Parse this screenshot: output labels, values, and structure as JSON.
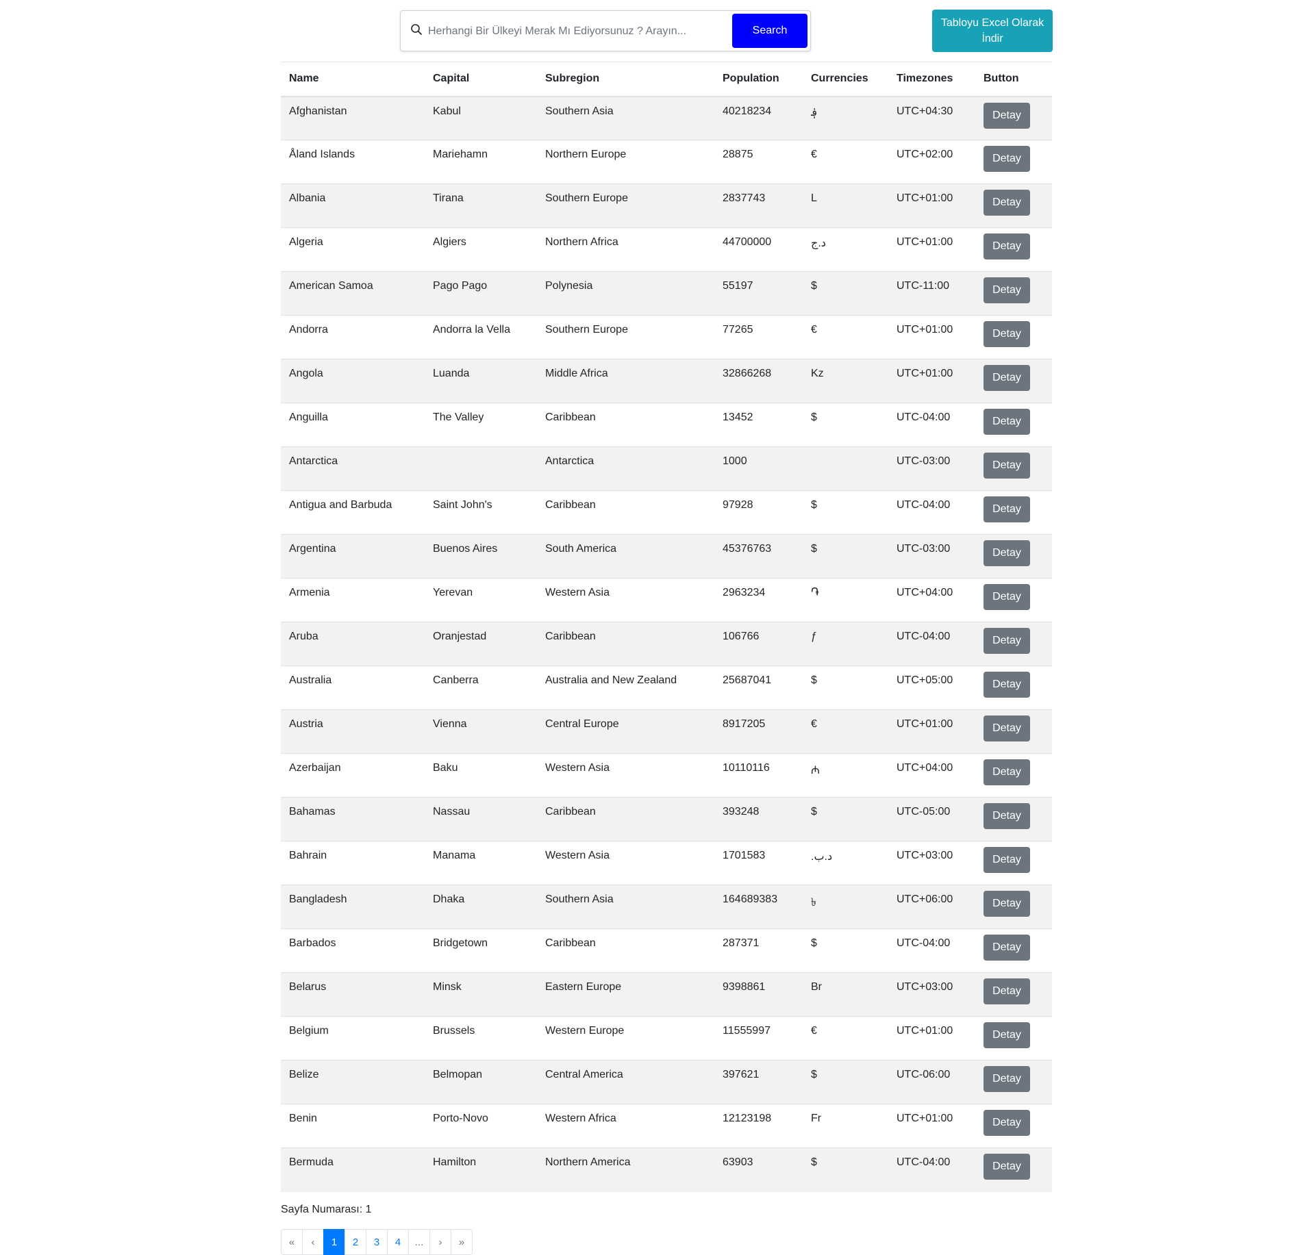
{
  "search": {
    "placeholder": "Herhangi Bir Ülkeyi Merak Mı Ediyorsunuz ? Arayın...",
    "button_label": "Search"
  },
  "excel_button_label": "Tabloyu Excel Olarak İndir",
  "table": {
    "columns": [
      "Name",
      "Capital",
      "Subregion",
      "Population",
      "Currencies",
      "Timezones",
      "Button"
    ],
    "detail_label": "Detay",
    "rows": [
      [
        "Afghanistan",
        "Kabul",
        "Southern Asia",
        "40218234",
        "؋",
        "UTC+04:30"
      ],
      [
        "Åland Islands",
        "Mariehamn",
        "Northern Europe",
        "28875",
        "€",
        "UTC+02:00"
      ],
      [
        "Albania",
        "Tirana",
        "Southern Europe",
        "2837743",
        "L",
        "UTC+01:00"
      ],
      [
        "Algeria",
        "Algiers",
        "Northern Africa",
        "44700000",
        "د.ج",
        "UTC+01:00"
      ],
      [
        "American Samoa",
        "Pago Pago",
        "Polynesia",
        "55197",
        "$",
        "UTC-11:00"
      ],
      [
        "Andorra",
        "Andorra la Vella",
        "Southern Europe",
        "77265",
        "€",
        "UTC+01:00"
      ],
      [
        "Angola",
        "Luanda",
        "Middle Africa",
        "32866268",
        "Kz",
        "UTC+01:00"
      ],
      [
        "Anguilla",
        "The Valley",
        "Caribbean",
        "13452",
        "$",
        "UTC-04:00"
      ],
      [
        "Antarctica",
        "",
        "Antarctica",
        "1000",
        "",
        "UTC-03:00"
      ],
      [
        "Antigua and Barbuda",
        "Saint John's",
        "Caribbean",
        "97928",
        "$",
        "UTC-04:00"
      ],
      [
        "Argentina",
        "Buenos Aires",
        "South America",
        "45376763",
        "$",
        "UTC-03:00"
      ],
      [
        "Armenia",
        "Yerevan",
        "Western Asia",
        "2963234",
        "֏",
        "UTC+04:00"
      ],
      [
        "Aruba",
        "Oranjestad",
        "Caribbean",
        "106766",
        "ƒ",
        "UTC-04:00"
      ],
      [
        "Australia",
        "Canberra",
        "Australia and New Zealand",
        "25687041",
        "$",
        "UTC+05:00"
      ],
      [
        "Austria",
        "Vienna",
        "Central Europe",
        "8917205",
        "€",
        "UTC+01:00"
      ],
      [
        "Azerbaijan",
        "Baku",
        "Western Asia",
        "10110116",
        "₼",
        "UTC+04:00"
      ],
      [
        "Bahamas",
        "Nassau",
        "Caribbean",
        "393248",
        "$",
        "UTC-05:00"
      ],
      [
        "Bahrain",
        "Manama",
        "Western Asia",
        "1701583",
        ".د.ب",
        "UTC+03:00"
      ],
      [
        "Bangladesh",
        "Dhaka",
        "Southern Asia",
        "164689383",
        "৳",
        "UTC+06:00"
      ],
      [
        "Barbados",
        "Bridgetown",
        "Caribbean",
        "287371",
        "$",
        "UTC-04:00"
      ],
      [
        "Belarus",
        "Minsk",
        "Eastern Europe",
        "9398861",
        "Br",
        "UTC+03:00"
      ],
      [
        "Belgium",
        "Brussels",
        "Western Europe",
        "11555997",
        "€",
        "UTC+01:00"
      ],
      [
        "Belize",
        "Belmopan",
        "Central America",
        "397621",
        "$",
        "UTC-06:00"
      ],
      [
        "Benin",
        "Porto-Novo",
        "Western Africa",
        "12123198",
        "Fr",
        "UTC+01:00"
      ],
      [
        "Bermuda",
        "Hamilton",
        "Northern America",
        "63903",
        "$",
        "UTC-04:00"
      ]
    ]
  },
  "page_number_text": "Sayfa Numarası: 1",
  "pagination": {
    "items": [
      "«",
      "‹",
      "1",
      "2",
      "3",
      "4",
      "...",
      "›",
      "»"
    ],
    "active": "1"
  }
}
